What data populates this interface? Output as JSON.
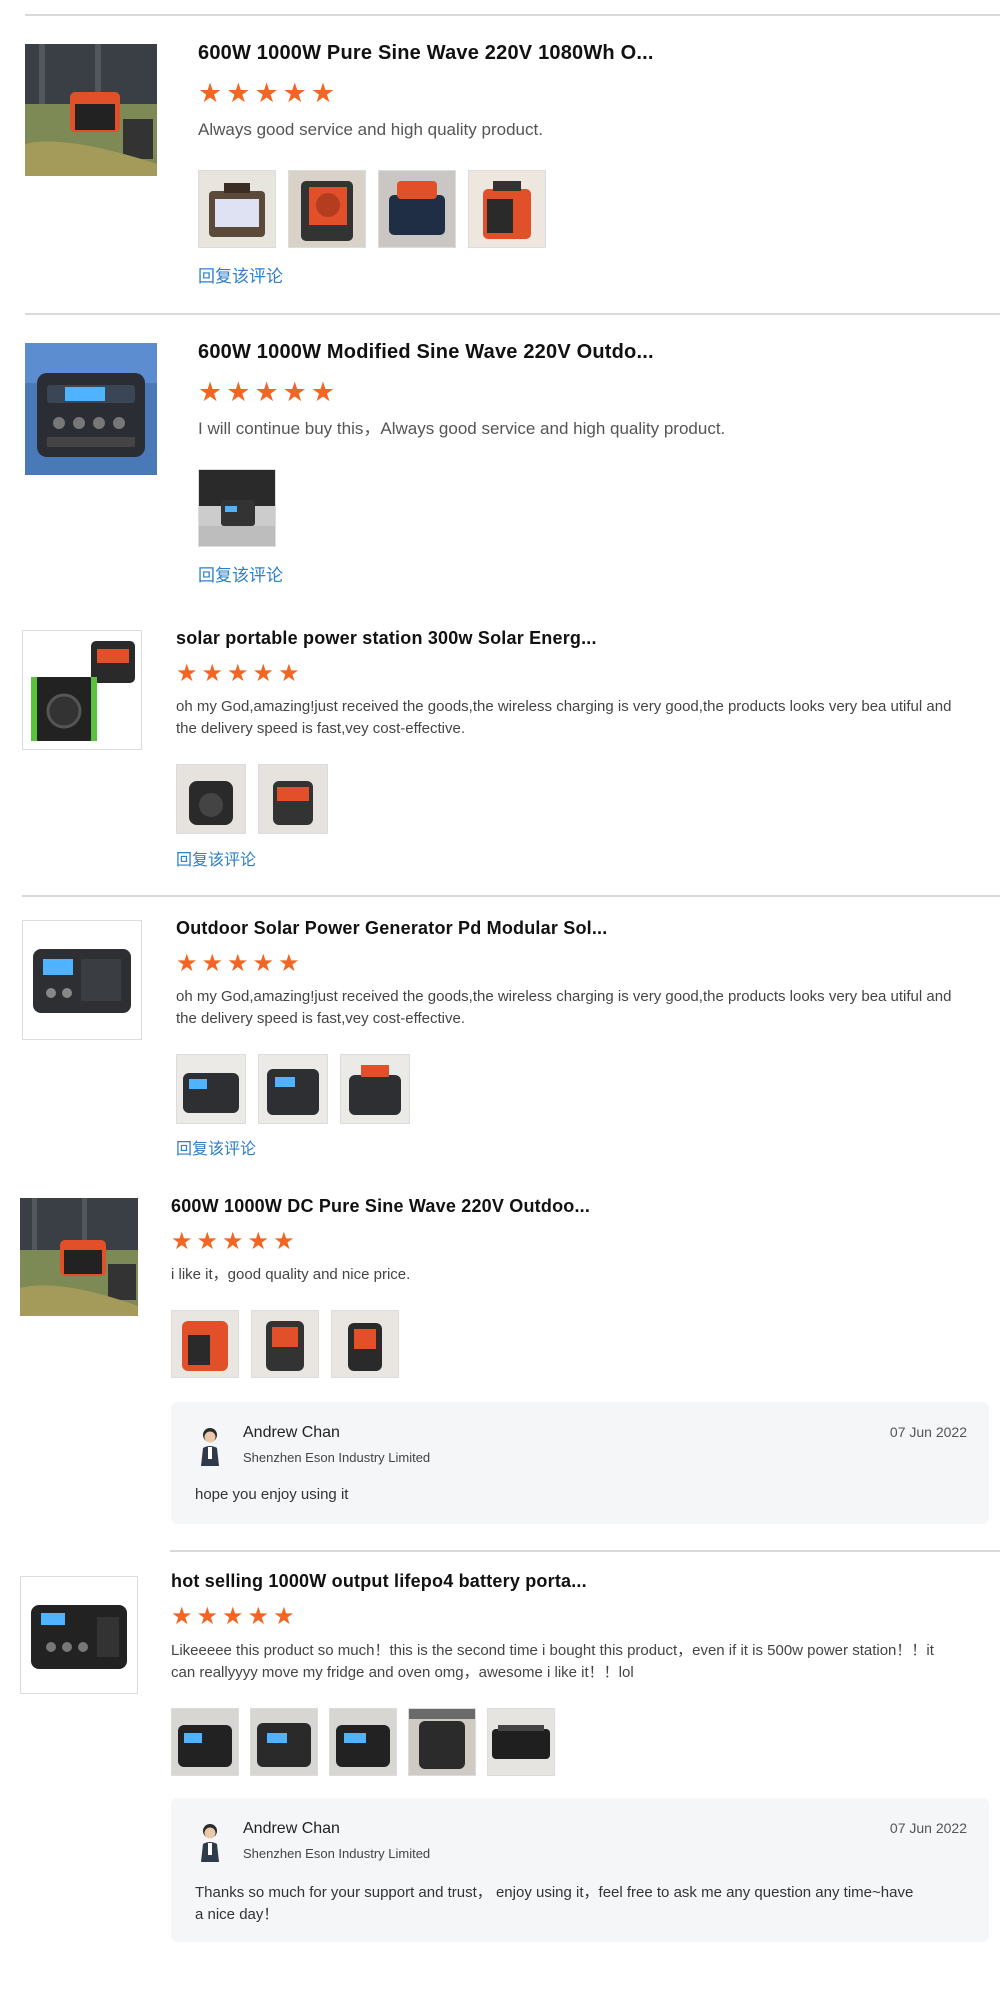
{
  "reviews": [
    {
      "title": "600W 1000W Pure Sine Wave 220V 1080Wh O...",
      "rating": 5,
      "text": "Always good service and high quality product.",
      "photo_count": 4,
      "reply_link": "回复该评论"
    },
    {
      "title": "600W 1000W Modified Sine Wave 220V Outdo...",
      "rating": 5,
      "text": "I will continue buy this，Always good service and high quality product.",
      "photo_count": 1,
      "reply_link": "回复该评论"
    },
    {
      "title": "solar portable power station 300w Solar Energ...",
      "rating": 5,
      "text": "oh my God,amazing!just received the goods,the wireless charging is very good,the products looks very bea utiful and the delivery speed is fast,vey cost-effective.",
      "photo_count": 2,
      "reply_link": "回复该评论"
    },
    {
      "title": "Outdoor Solar Power Generator Pd Modular Sol...",
      "rating": 5,
      "text": "oh my God,amazing!just received the goods,the wireless charging is very good,the products looks very bea utiful and the delivery speed is fast,vey cost-effective.",
      "photo_count": 3,
      "reply_link": "回复该评论"
    },
    {
      "title": "600W 1000W DC Pure Sine Wave 220V Outdoo...",
      "rating": 5,
      "text": "i like it，good quality and nice price.",
      "photo_count": 3,
      "reply": {
        "name": "Andrew Chan",
        "company": "Shenzhen Eson Industry Limited",
        "date": "07 Jun 2022",
        "message": "hope you enjoy using it"
      }
    },
    {
      "title": "hot selling 1000W output lifepo4 battery porta...",
      "rating": 5,
      "text": "Likeeeee this product so much！this is the second time i bought this product，even if it is 500w power station！！it can reallyyyy move my fridge and oven omg，awesome i like it！！lol",
      "photo_count": 5,
      "reply": {
        "name": "Andrew Chan",
        "company": "Shenzhen Eson Industry Limited",
        "date": "07 Jun 2022",
        "message": "Thanks so much for your support and trust， enjoy using it，feel free to ask me any question any time~have a nice day！"
      }
    }
  ],
  "colors": {
    "star": "#f26522",
    "link": "#2d7ecb",
    "reply_bg": "#f5f6f8",
    "divider": "#d9d9d9"
  },
  "icons": {
    "star": "star-icon",
    "avatar": "avatar-icon"
  }
}
